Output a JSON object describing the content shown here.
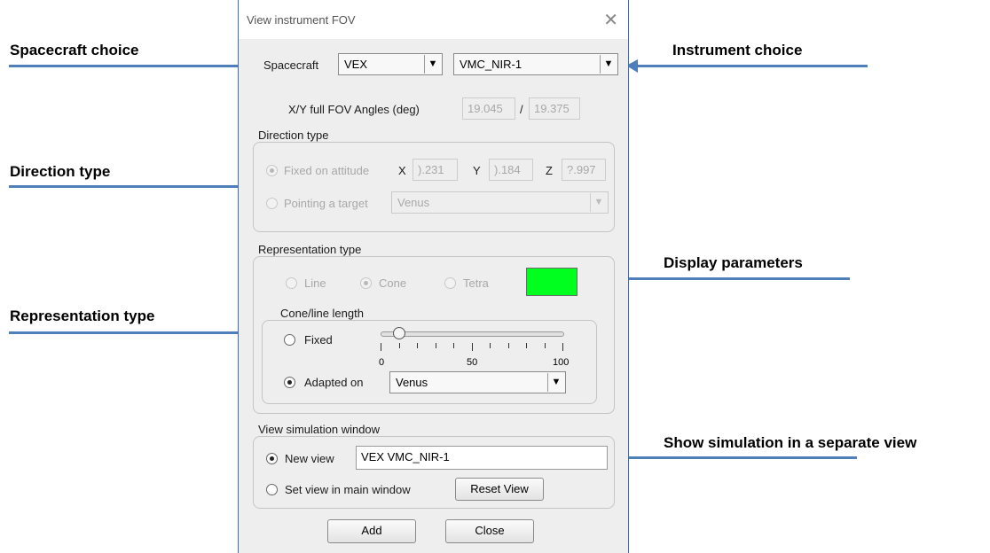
{
  "annotations": {
    "spacecraft_choice": "Spacecraft choice",
    "instrument_choice": "Instrument choice",
    "direction_type": "Direction type",
    "display_parameters": "Display parameters",
    "representation_type": "Representation type",
    "show_simulation": "Show simulation in a separate view"
  },
  "dialog": {
    "title": "View instrument FOV",
    "close_icon": "close-icon",
    "spacecraft": {
      "label": "Spacecraft",
      "value": "VEX"
    },
    "instrument": {
      "value": "VMC_NIR-1"
    },
    "fov": {
      "label": "X/Y full FOV Angles (deg)",
      "x": "19.045",
      "separator": "/",
      "y": "19.375"
    },
    "direction_type": {
      "legend": "Direction type",
      "fixed_on_attitude": "Fixed on attitude",
      "x_label": "X",
      "x_value": ").231",
      "y_label": "Y",
      "y_value": ").184",
      "z_label": "Z",
      "z_value": "?.997",
      "pointing_target": "Pointing a target",
      "target_value": "Venus"
    },
    "representation_type": {
      "legend": "Representation type",
      "line": "Line",
      "cone": "Cone",
      "tetra": "Tetra",
      "color": "#00ff1e",
      "cone_line_length": {
        "legend": "Cone/line length",
        "fixed": "Fixed",
        "slider_value": 10,
        "tick_min": "0",
        "tick_mid": "50",
        "tick_max": "100",
        "adapted_on": "Adapted on",
        "adapted_value": "Venus"
      }
    },
    "view_window": {
      "legend": "View simulation window",
      "new_view": "New view",
      "new_view_name": "VEX VMC_NIR-1",
      "set_main": "Set view in main window",
      "reset_view": "Reset View"
    },
    "add": "Add",
    "close": "Close"
  }
}
